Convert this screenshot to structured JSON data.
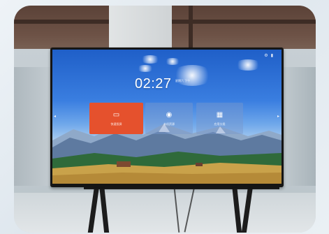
{
  "screen": {
    "clock_time": "02:27",
    "date_line1": "星期六 下午",
    "date_line2": "",
    "tiles": [
      {
        "label": "快速投屏",
        "icon": "cast-screen-icon"
      },
      {
        "label": "本机资源",
        "icon": "record-icon"
      },
      {
        "label": "应用分类",
        "icon": "apps-grid-icon"
      }
    ],
    "status_icons": [
      "settings-icon",
      "wifi-icon"
    ],
    "accent_color": "#e5512d"
  }
}
